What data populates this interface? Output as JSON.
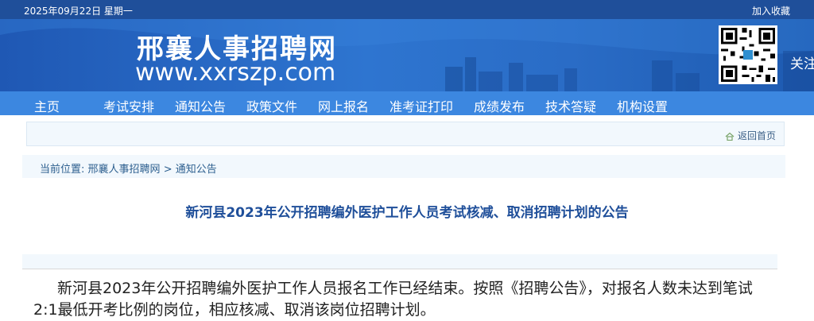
{
  "topbar": {
    "date": "2025年09月22日 星期一",
    "favorite": "加入收藏"
  },
  "site": {
    "name": "邢襄人事招聘网",
    "url": "www.xxrszp.com",
    "follow": "关注"
  },
  "nav": [
    "主页",
    "考试安排",
    "通知公告",
    "政策文件",
    "网上报名",
    "准考证打印",
    "成绩发布",
    "技术答疑",
    "机构设置"
  ],
  "back": {
    "label": "返回首页"
  },
  "breadcrumb": {
    "prefix": "当前位置:",
    "home": "邢襄人事招聘网",
    "sep": ">",
    "current": "通知公告"
  },
  "article": {
    "title": "新河县2023年公开招聘编外医护工作人员考试核减、取消招聘计划的公告",
    "body": "新河县2023年公开招聘编外医护工作人员报名工作已经结束。按照《招聘公告》，对报名人数未达到笔试2:1最低开考比例的岗位，相应核减、取消该岗位招聘计划。"
  },
  "colors": {
    "topbar": "#1f4f9a",
    "nav": "#3c87e0",
    "title": "#1f4f9a"
  }
}
